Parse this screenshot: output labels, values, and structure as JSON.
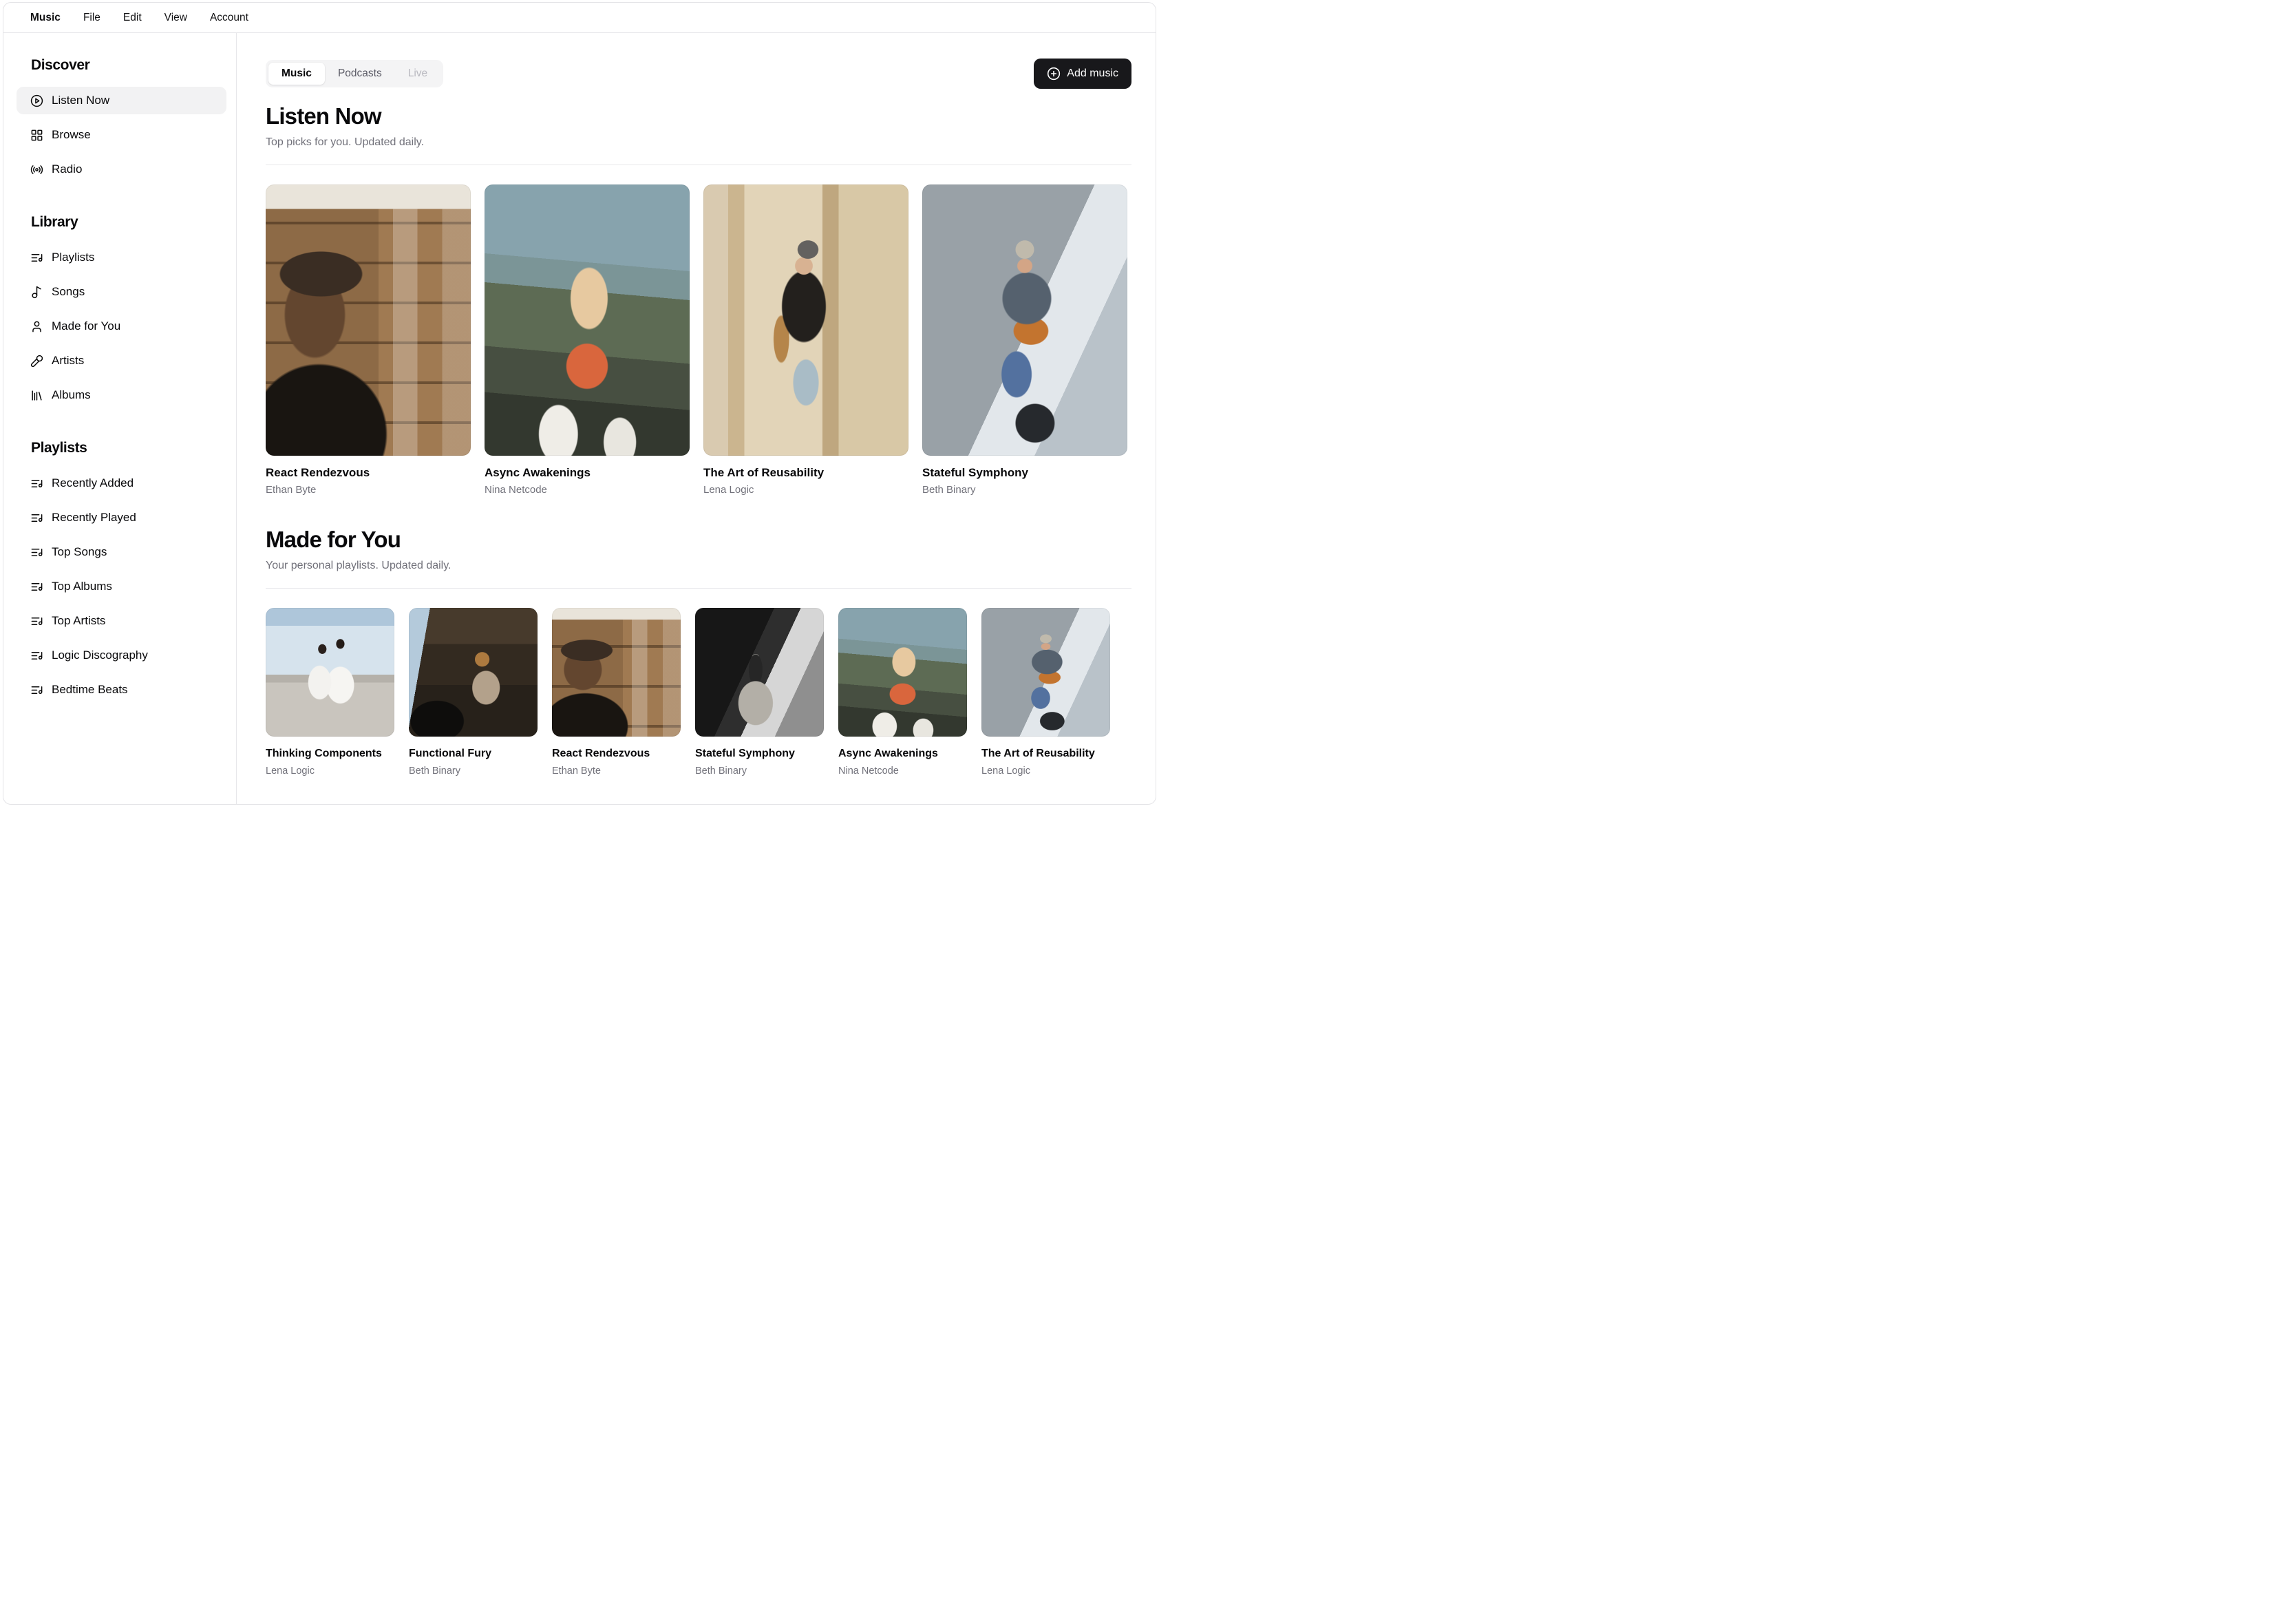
{
  "menubar": {
    "items": [
      {
        "label": "Music"
      },
      {
        "label": "File"
      },
      {
        "label": "Edit"
      },
      {
        "label": "View"
      },
      {
        "label": "Account"
      }
    ]
  },
  "sidebar": {
    "sections": [
      {
        "heading": "Discover",
        "items": [
          {
            "label": "Listen Now",
            "icon": "circle-play-icon",
            "active": true
          },
          {
            "label": "Browse",
            "icon": "layout-grid-icon",
            "active": false
          },
          {
            "label": "Radio",
            "icon": "radio-icon",
            "active": false
          }
        ]
      },
      {
        "heading": "Library",
        "items": [
          {
            "label": "Playlists",
            "icon": "list-music-icon",
            "active": false
          },
          {
            "label": "Songs",
            "icon": "music-note-icon",
            "active": false
          },
          {
            "label": "Made for You",
            "icon": "user-icon",
            "active": false
          },
          {
            "label": "Artists",
            "icon": "microphone-icon",
            "active": false
          },
          {
            "label": "Albums",
            "icon": "library-icon",
            "active": false
          }
        ]
      },
      {
        "heading": "Playlists",
        "items": [
          {
            "label": "Recently Added",
            "icon": "list-music-icon",
            "active": false
          },
          {
            "label": "Recently Played",
            "icon": "list-music-icon",
            "active": false
          },
          {
            "label": "Top Songs",
            "icon": "list-music-icon",
            "active": false
          },
          {
            "label": "Top Albums",
            "icon": "list-music-icon",
            "active": false
          },
          {
            "label": "Top Artists",
            "icon": "list-music-icon",
            "active": false
          },
          {
            "label": "Logic Discography",
            "icon": "list-music-icon",
            "active": false
          },
          {
            "label": "Bedtime Beats",
            "icon": "list-music-icon",
            "active": false
          }
        ]
      }
    ]
  },
  "toolbar": {
    "tabs": [
      {
        "label": "Music",
        "state": "active"
      },
      {
        "label": "Podcasts",
        "state": "default"
      },
      {
        "label": "Live",
        "state": "disabled"
      }
    ],
    "add_music_label": "Add music"
  },
  "sections": [
    {
      "title": "Listen Now",
      "subtitle": "Top picks for you. Updated daily.",
      "card_size": "large",
      "albums": [
        {
          "title": "React Rendezvous",
          "artist": "Ethan Byte",
          "art": "headphones-bookshelf"
        },
        {
          "title": "Async Awakenings",
          "artist": "Nina Netcode",
          "art": "window-reflection"
        },
        {
          "title": "The Art of Reusability",
          "artist": "Lena Logic",
          "art": "sax-street"
        },
        {
          "title": "Stateful Symphony",
          "artist": "Beth Binary",
          "art": "street-guitarist"
        }
      ]
    },
    {
      "title": "Made for You",
      "subtitle": "Your personal playlists. Updated daily.",
      "card_size": "small",
      "albums": [
        {
          "title": "Thinking Components",
          "artist": "Lena Logic",
          "art": "marina-duo"
        },
        {
          "title": "Functional Fury",
          "artist": "Beth Binary",
          "art": "piano-room"
        },
        {
          "title": "React Rendezvous",
          "artist": "Ethan Byte",
          "art": "headphones-bookshelf"
        },
        {
          "title": "Stateful Symphony",
          "artist": "Beth Binary",
          "art": "bw-chair"
        },
        {
          "title": "Async Awakenings",
          "artist": "Nina Netcode",
          "art": "window-reflection"
        },
        {
          "title": "The Art of Reusability",
          "artist": "Lena Logic",
          "art": "street-guitarist"
        }
      ]
    }
  ],
  "colors": {
    "accent_dark": "#18181b",
    "muted_text": "#71717a",
    "active_item_bg": "#f2f2f3",
    "tab_track_bg": "#f4f4f5",
    "border": "#e4e4e7"
  }
}
